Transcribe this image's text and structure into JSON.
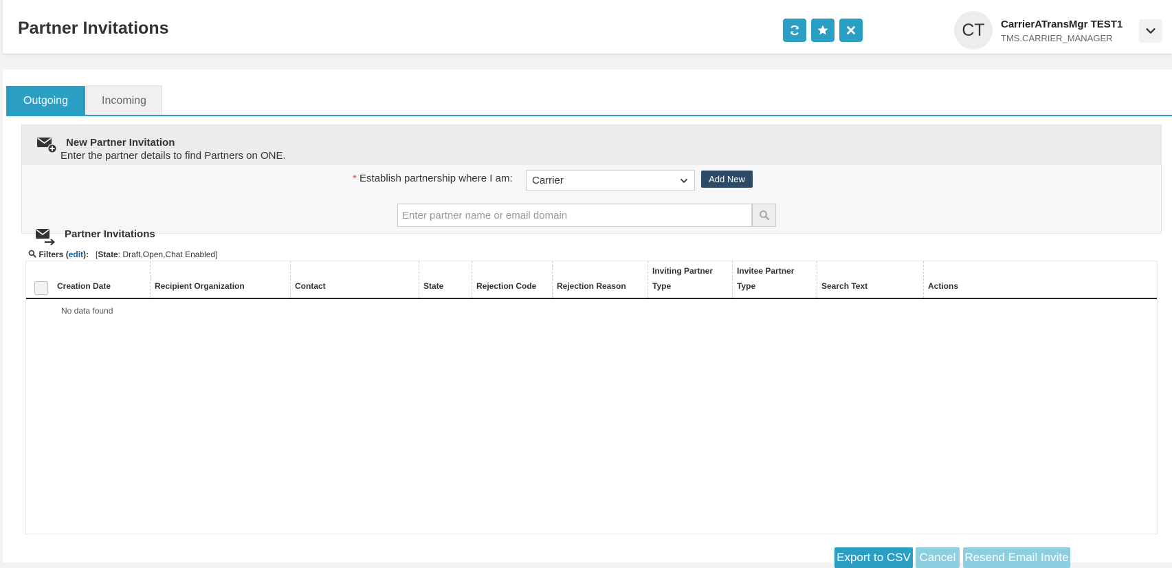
{
  "header": {
    "title": "Partner Invitations",
    "buttons": [
      {
        "name": "refresh-icon"
      },
      {
        "name": "star-icon"
      },
      {
        "name": "close-icon"
      }
    ],
    "user": {
      "initials": "CT",
      "name": "CarrierATransMgr TEST1",
      "role": "TMS.CARRIER_MANAGER"
    }
  },
  "tabs": [
    {
      "label": "Outgoing",
      "active": true
    },
    {
      "label": "Incoming",
      "active": false
    }
  ],
  "new_invitation": {
    "title": "New Partner Invitation",
    "subtitle": "Enter the partner details to find Partners on ONE.",
    "required_mark": "*",
    "establish_label": "Establish partnership where I am:",
    "role_value": "Carrier",
    "add_new_label": "Add New",
    "search_placeholder": "Enter partner name or email domain"
  },
  "invitations": {
    "title": "Partner Invitations",
    "filters_label": "Filters",
    "filters_edit": "edit",
    "filter_state_key": "State",
    "filter_state_values": "Draft,Open,Chat Enabled",
    "columns": [
      [
        "Creation Date"
      ],
      [
        "Recipient Organization"
      ],
      [
        "Contact"
      ],
      [
        "State"
      ],
      [
        "Rejection Code"
      ],
      [
        "Rejection Reason"
      ],
      [
        "Inviting Partner",
        "Type"
      ],
      [
        "Invitee Partner",
        "Type"
      ],
      [
        "Search Text"
      ],
      [
        "Actions"
      ]
    ],
    "empty_text": "No data found"
  },
  "footer": {
    "export_label": "Export to CSV",
    "cancel_label": "Cancel",
    "resend_label": "Resend Email Invite"
  },
  "colors": {
    "primary": "#2a9fc3",
    "dark_button": "#2d4a66",
    "disabled_button": "#8ccfe1"
  }
}
